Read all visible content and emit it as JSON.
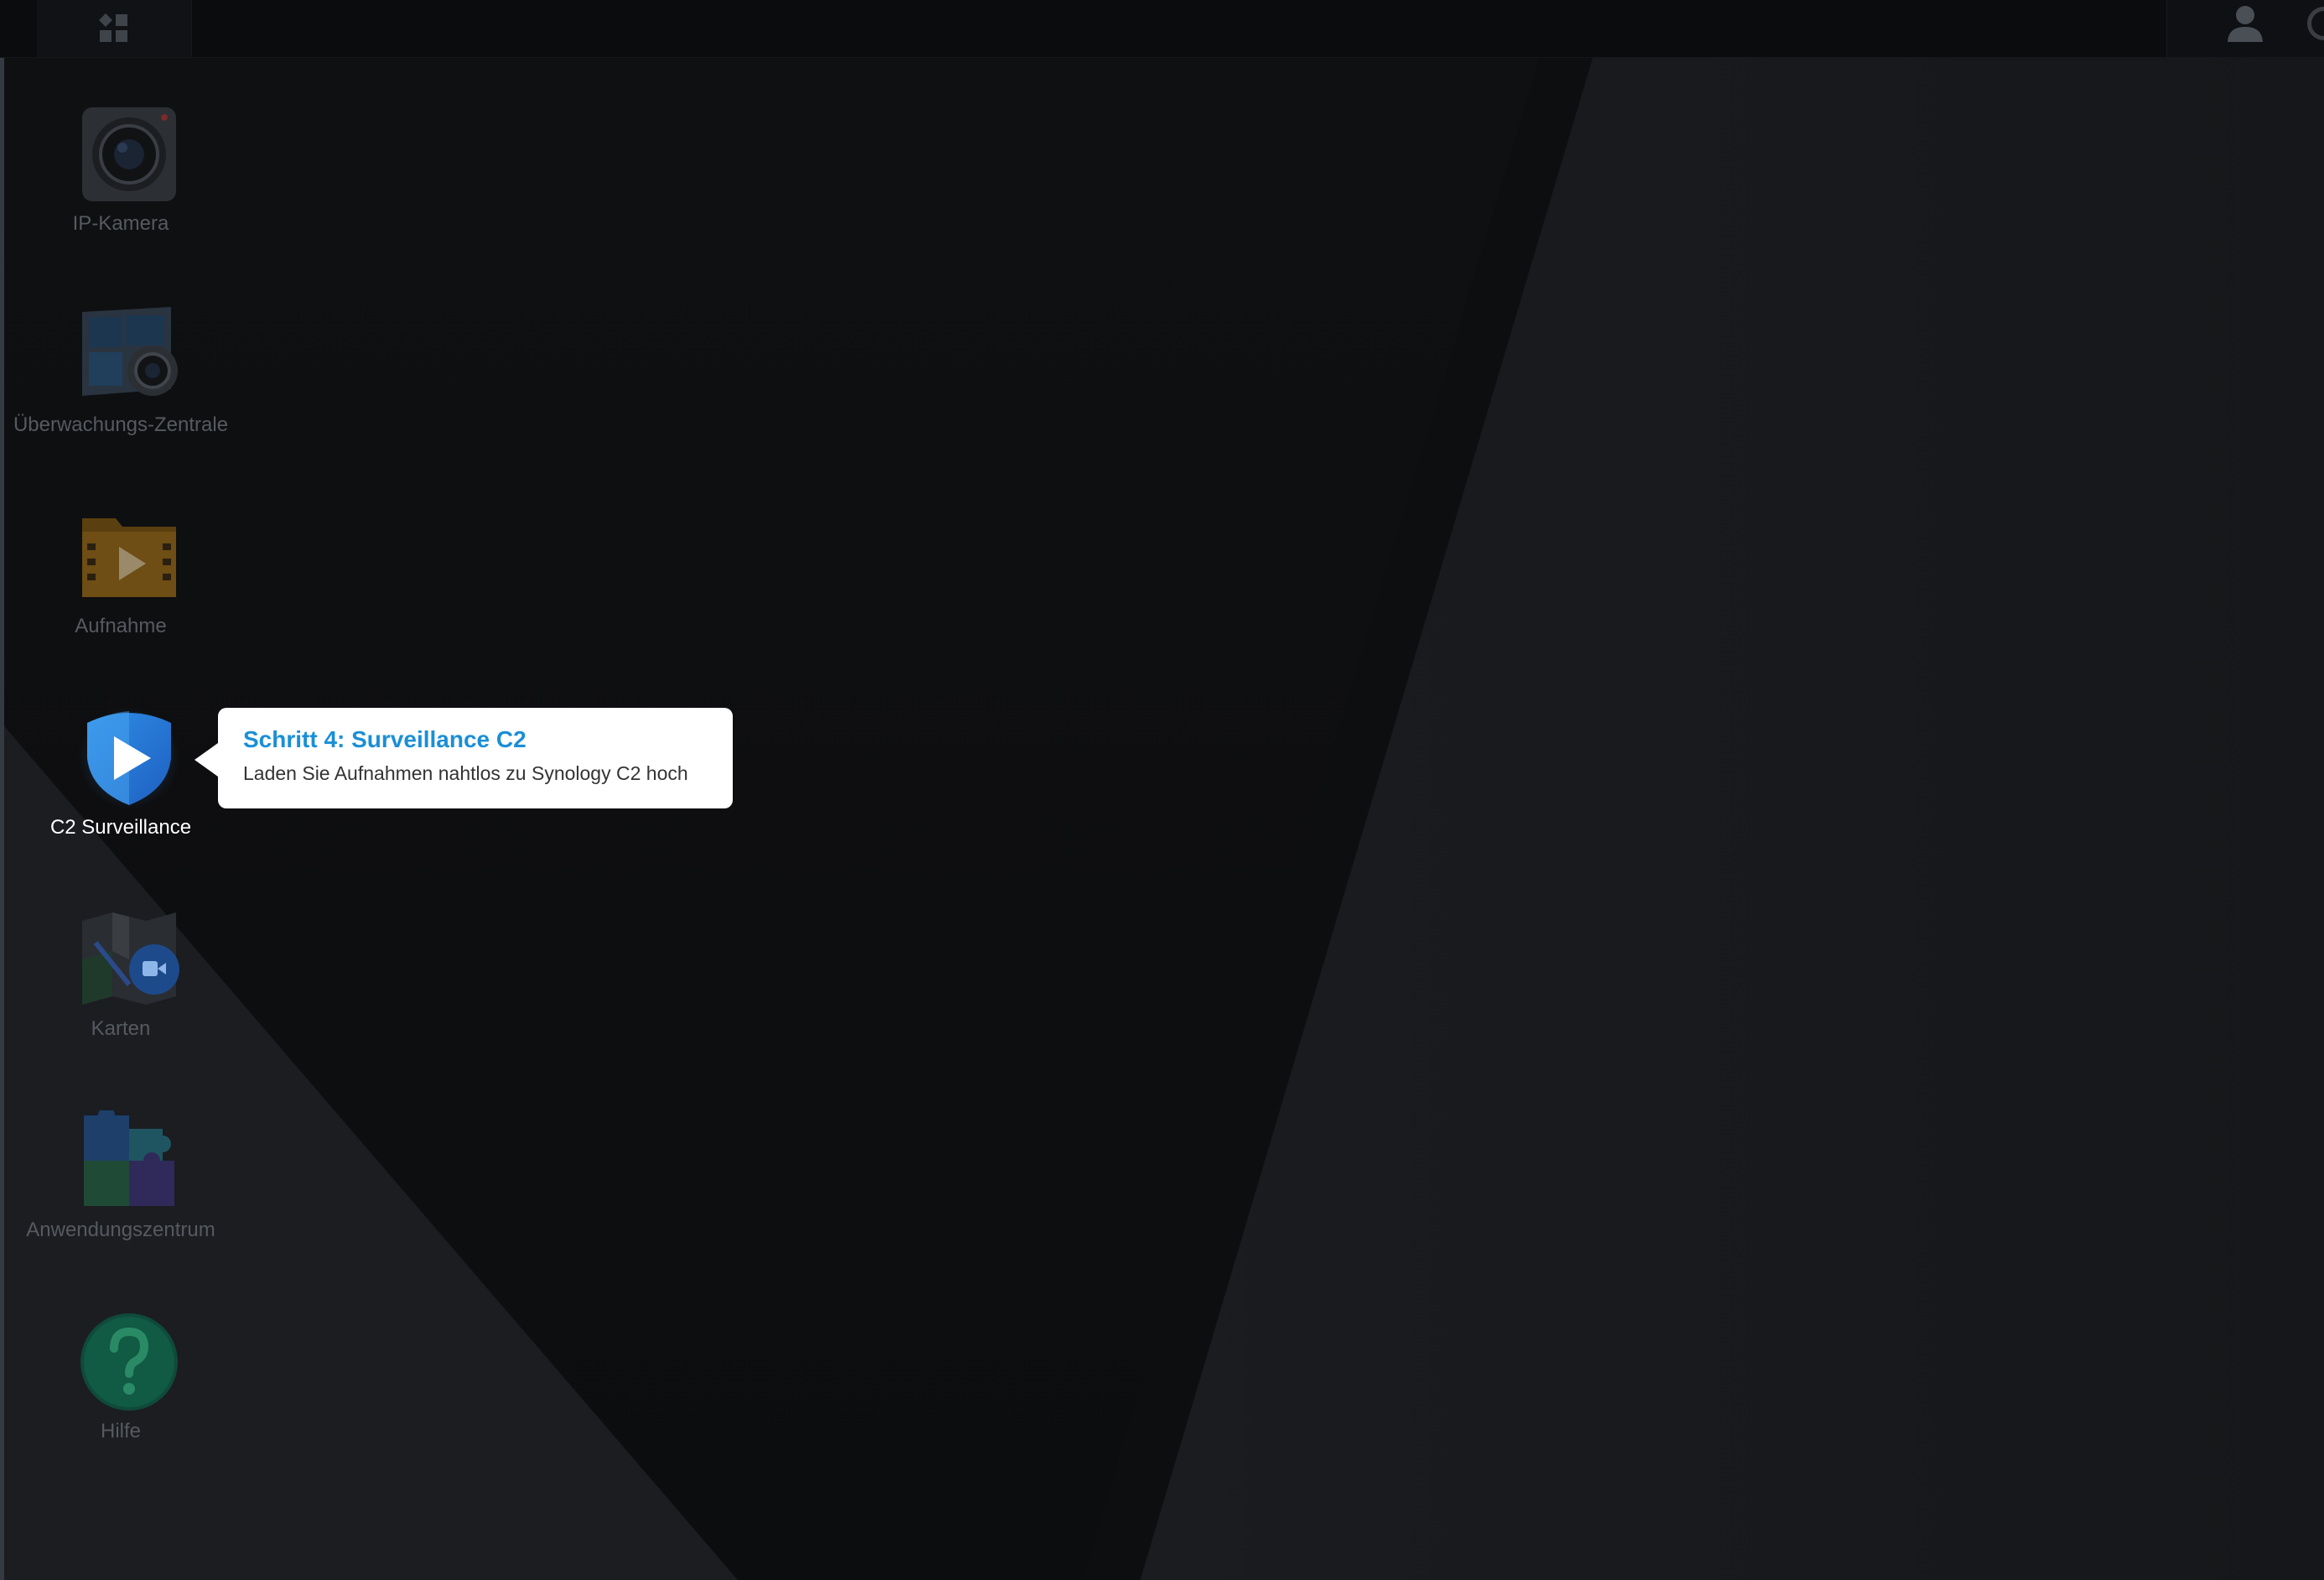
{
  "taskbar": {
    "main_menu_icon": "grid-icon",
    "user_icon": "user-icon",
    "options_icon": "options-icon"
  },
  "desktop": {
    "icons": [
      {
        "label": "IP-Kamera",
        "icon": "ip-camera-icon"
      },
      {
        "label": "Überwachungs-Zentrale",
        "icon": "monitor-center-icon"
      },
      {
        "label": "Aufnahme",
        "icon": "recording-folder-icon"
      },
      {
        "label": "C2 Surveillance",
        "icon": "c2-shield-icon"
      },
      {
        "label": "Karten",
        "icon": "map-icon"
      },
      {
        "label": "Anwendungszentrum",
        "icon": "puzzle-icon"
      },
      {
        "label": "Hilfe",
        "icon": "help-icon"
      }
    ]
  },
  "tooltip": {
    "title": "Schritt 4: Surveillance C2",
    "body": "Laden Sie Aufnahmen nahtlos zu Synology C2 hoch"
  },
  "colors": {
    "background": "#101113",
    "taskbar": "#0b0c0e",
    "tooltip_title": "#1a8fd6",
    "label_dim": "#565a60",
    "label_active": "#ffffff"
  }
}
